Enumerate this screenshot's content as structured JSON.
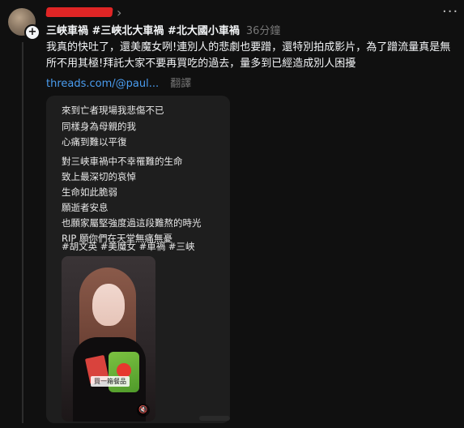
{
  "post": {
    "title": "三峽車禍 #三峽北大車禍 #北大國小車禍",
    "time": "36分鐘",
    "body": "我真的快吐了，還美魔女咧!連別人的悲劇也要蹭，還特別拍成影片，為了蹭流量真是無所不用其極!拜託大家不要再買吃的過去，量多到已經造成別人困擾",
    "link": "threads.com/@paul...",
    "translate_label": "翻譯",
    "more_glyph": "···",
    "chevron_glyph": "›",
    "plus_glyph": "+"
  },
  "card": {
    "lines": [
      "來到亡者現場我悲傷不已",
      "同樣身為母親的我",
      "心痛到難以平復",
      "對三峽車禍中不幸罹難的生命",
      "致上最深切的哀悼",
      "生命如此脆弱",
      "願逝者安息",
      "也願家屬堅強度過這段難熬的時光",
      "RIP 願你們在天堂無痛無憂",
      "#胡文英 #美魔女 #車禍 #三峽"
    ],
    "photo_caption": "買一箱餐品",
    "mute_glyph": "🔇"
  },
  "icons": {
    "avatar": "avatar",
    "follow": "plus-icon",
    "more": "more-icon",
    "mute": "mute-icon"
  },
  "colors": {
    "background": "#101010",
    "link": "#4a9df0",
    "redaction": "#e02525",
    "card": "#1e1e1e"
  }
}
